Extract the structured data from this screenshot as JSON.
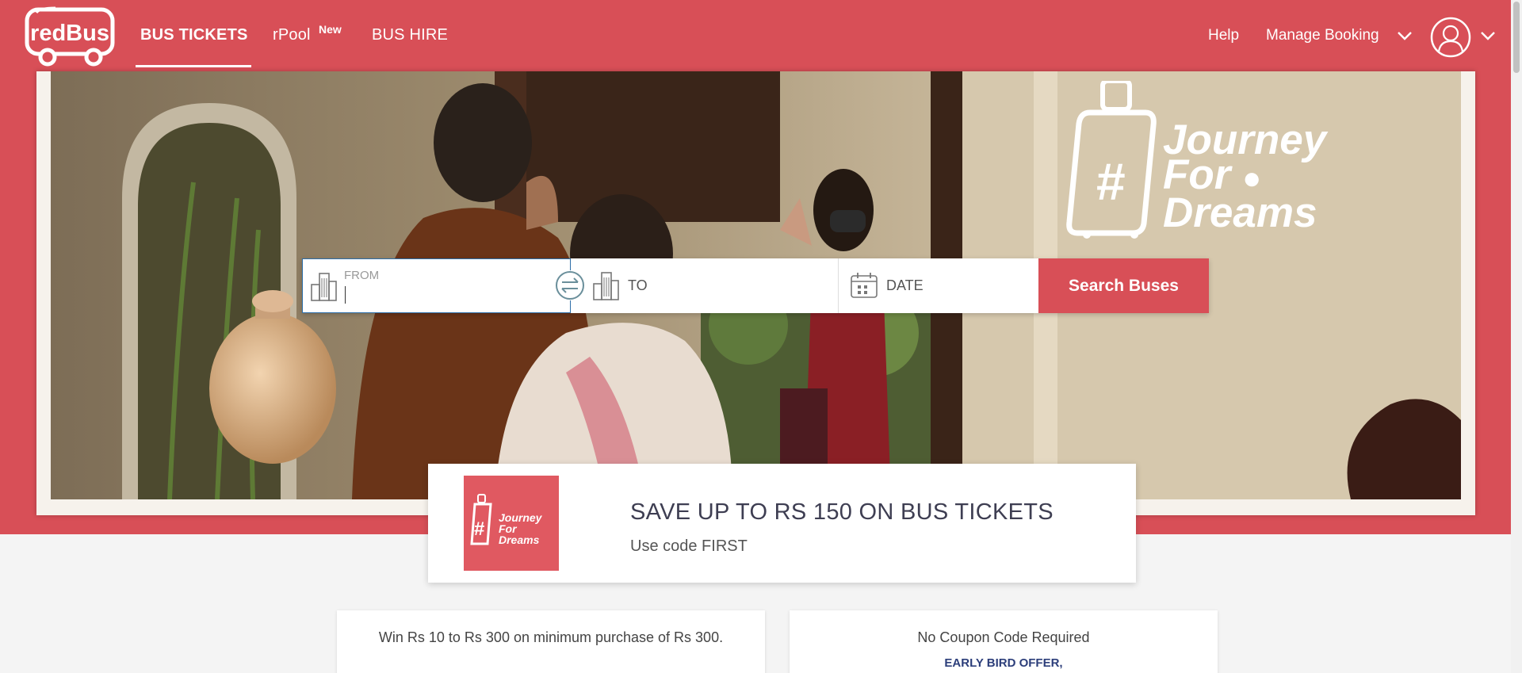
{
  "header": {
    "brand": "redBus",
    "nav": {
      "bus_tickets": "BUS TICKETS",
      "rpool": "rPool",
      "rpool_badge": "New",
      "bus_hire": "BUS HIRE"
    },
    "help": "Help",
    "manage_booking": "Manage Booking",
    "icons": [
      "chevron-down-icon",
      "user-avatar-icon"
    ]
  },
  "hero": {
    "campaign": {
      "hashtag": "#",
      "line1": "Journey",
      "line2": "For",
      "line3": "Dreams"
    }
  },
  "search": {
    "from_label": "FROM",
    "from_value": "",
    "to_label": "TO",
    "date_label": "DATE",
    "button": "Search Buses"
  },
  "offer": {
    "title": "SAVE UP TO RS 150 ON BUS TICKETS",
    "subtitle": "Use code FIRST",
    "thumb": {
      "hashtag": "#",
      "line1": "Journey",
      "line2": "For",
      "line3": "Dreams"
    }
  },
  "cards": [
    {
      "text": "Win Rs 10 to Rs 300 on minimum purchase of Rs 300."
    },
    {
      "text": "No Coupon Code Required",
      "subtext": "EARLY BIRD OFFER,"
    }
  ],
  "colors": {
    "brand_red": "#d84f57",
    "text_dark": "#3e3e52",
    "link_blue": "#2c3e7a"
  }
}
